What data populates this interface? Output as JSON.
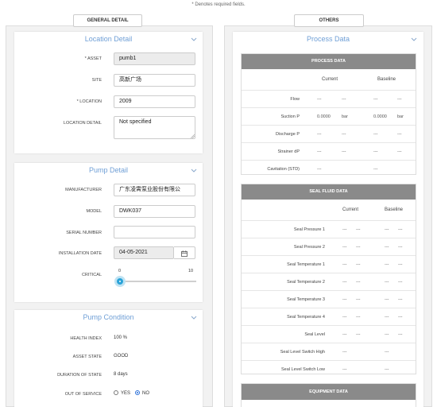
{
  "required_note": "* Denotes required fields.",
  "tabs": {
    "general": "GENERAL DETAIL",
    "others": "OTHERS"
  },
  "location_card": {
    "title": "Location Detail",
    "asset_label": "* ASSET",
    "asset_value": "pumb1",
    "site_label": "SITE",
    "site_value": "高新广场",
    "location_label": "* LOCATION",
    "location_value": "2009",
    "detail_label": "LOCATION DETAIL",
    "detail_value": "Not specified"
  },
  "pump_card": {
    "title": "Pump Detail",
    "manufacturer_label": "MANUFACTURER",
    "manufacturer_value": "广东凌霄泵业股份有限公",
    "model_label": "MODEL",
    "model_value": "DWK037",
    "serial_label": "SERIAL NUMBER",
    "serial_value": "",
    "install_label": "INSTALLATION DATE",
    "install_value": "04-05-2021",
    "critical_label": "CRITICAL",
    "critical_min": "0",
    "critical_max": "10",
    "critical_value": 0
  },
  "condition_card": {
    "title": "Pump Condition",
    "health_label": "HEALTH INDEX",
    "health_value": "100 %",
    "state_label": "ASSET STATE",
    "state_value": "GOOD",
    "duration_label": "DURATION OF STATE",
    "duration_value": "8 days",
    "oos_label": "OUT OF SERVICE",
    "oos_yes": "YES",
    "oos_no": "NO",
    "oos_selected": "NO"
  },
  "process_card": {
    "title": "Process Data"
  },
  "process_table": {
    "header": "PROCESS DATA",
    "col_current": "Current",
    "col_baseline": "Baseline",
    "rows": [
      {
        "label": "Flow",
        "c1": "---",
        "c2": "---",
        "b1": "---",
        "b2": "---"
      },
      {
        "label": "Suction P",
        "c1": "0.0000",
        "c2": "bar",
        "b1": "0.0000",
        "b2": "bar"
      },
      {
        "label": "Discharge P",
        "c1": "---",
        "c2": "---",
        "b1": "---",
        "b2": "---"
      },
      {
        "label": "Strainer dP",
        "c1": "---",
        "c2": "---",
        "b1": "---",
        "b2": "---"
      },
      {
        "label": "Cavitation (STD)",
        "c1": "---",
        "c2": "",
        "b1": "---",
        "b2": ""
      }
    ]
  },
  "seal_table": {
    "header": "SEAL FLUID DATA",
    "col_current": "Current",
    "col_baseline": "Baseline",
    "rows": [
      {
        "label": "Seal Pressure 1",
        "c1": "---",
        "c2": "---",
        "b1": "---",
        "b2": "---"
      },
      {
        "label": "Seal Pressure 2",
        "c1": "---",
        "c2": "---",
        "b1": "---",
        "b2": "---"
      },
      {
        "label": "Seal Temperature 1",
        "c1": "---",
        "c2": "---",
        "b1": "---",
        "b2": "---"
      },
      {
        "label": "Seal Temperature 2",
        "c1": "---",
        "c2": "---",
        "b1": "---",
        "b2": "---"
      },
      {
        "label": "Seal Temperature 3",
        "c1": "---",
        "c2": "---",
        "b1": "---",
        "b2": "---"
      },
      {
        "label": "Seal Temperature 4",
        "c1": "---",
        "c2": "---",
        "b1": "---",
        "b2": "---"
      },
      {
        "label": "Seal Level",
        "c1": "---",
        "c2": "---",
        "b1": "---",
        "b2": "---"
      },
      {
        "label": "Seal Level Switch High",
        "c1": "---",
        "c2": "",
        "b1": "---",
        "b2": ""
      },
      {
        "label": "Seal Level Switch Low",
        "c1": "---",
        "c2": "",
        "b1": "---",
        "b2": ""
      }
    ]
  },
  "equipment_table": {
    "header": "EQUIPMENT DATA"
  },
  "colors": {
    "accent": "#2aa3d8",
    "title_blue": "#6f9fd6",
    "table_header": "#8a8a8a"
  }
}
